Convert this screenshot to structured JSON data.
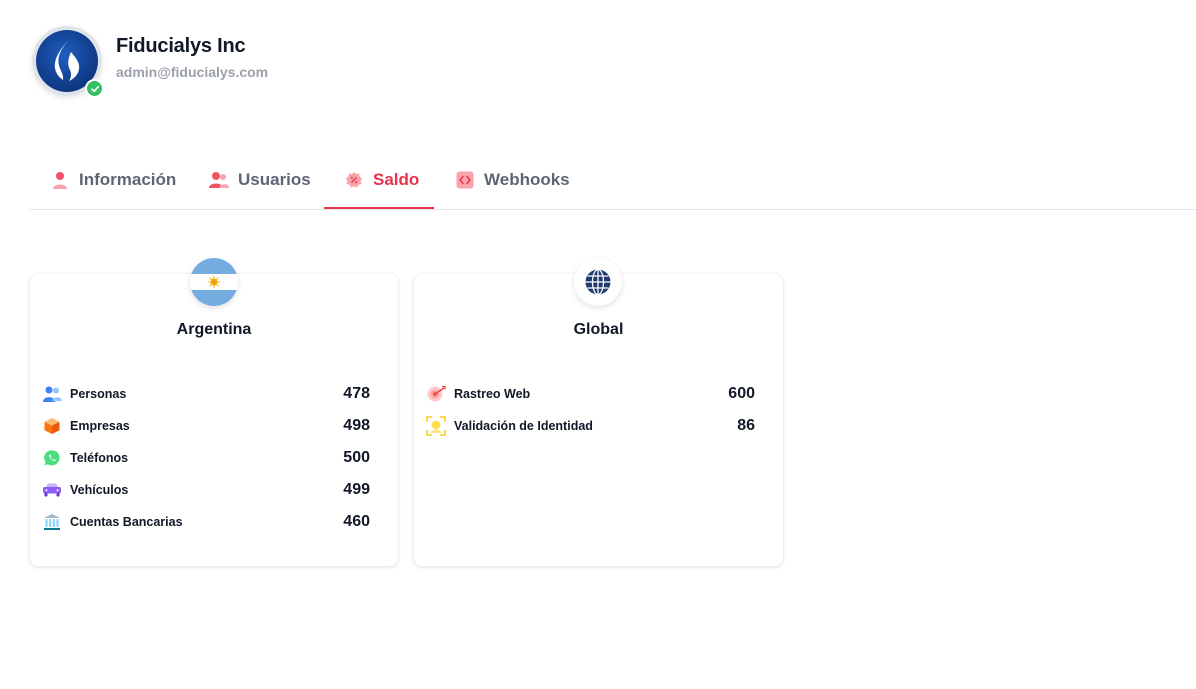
{
  "profile": {
    "company_name": "Fiducialys Inc",
    "email": "admin@fiducialys.com",
    "avatar_icon": "flame-logo",
    "verified_icon": "check-icon"
  },
  "tabs": [
    {
      "label": "Información",
      "icon": "user-icon",
      "active": false
    },
    {
      "label": "Usuarios",
      "icon": "users-icon",
      "active": false
    },
    {
      "label": "Saldo",
      "icon": "percent-badge-icon",
      "active": true
    },
    {
      "label": "Webhooks",
      "icon": "code-icon",
      "active": false
    }
  ],
  "colors": {
    "accent": "#e8334a",
    "muted_text": "#5f6673",
    "verified": "#34c063"
  },
  "cards": [
    {
      "title": "Argentina",
      "badge_icon": "argentina-flag-icon",
      "rows": [
        {
          "label": "Personas",
          "value": "478",
          "icon": "people-icon"
        },
        {
          "label": "Empresas",
          "value": "498",
          "icon": "box-icon"
        },
        {
          "label": "Teléfonos",
          "value": "500",
          "icon": "whatsapp-icon"
        },
        {
          "label": "Vehículos",
          "value": "499",
          "icon": "car-icon"
        },
        {
          "label": "Cuentas Bancarias",
          "value": "460",
          "icon": "bank-icon"
        }
      ]
    },
    {
      "title": "Global",
      "badge_icon": "globe-icon",
      "rows": [
        {
          "label": "Rastreo Web",
          "value": "600",
          "icon": "target-icon"
        },
        {
          "label": "Validación de Identidad",
          "value": "86",
          "icon": "face-scan-icon"
        }
      ]
    }
  ]
}
